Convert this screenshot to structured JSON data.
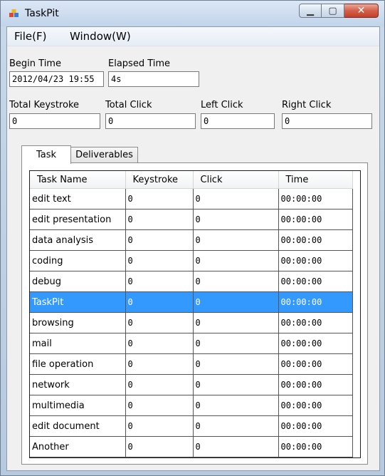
{
  "window": {
    "title": "TaskPit"
  },
  "menu": [
    "File(F)",
    "Window(W)"
  ],
  "fields": {
    "begin_time_label": "Begin Time",
    "begin_time_value": "2012/04/23 19:55",
    "elapsed_time_label": "Elapsed Time",
    "elapsed_time_value": "4s",
    "total_keystroke_label": "Total Keystroke",
    "total_keystroke_value": "0",
    "total_click_label": "Total Click",
    "total_click_value": "0",
    "left_click_label": "Left Click",
    "left_click_value": "0",
    "right_click_label": "Right Click",
    "right_click_value": "0"
  },
  "tabs": [
    "Task",
    "Deliverables"
  ],
  "table": {
    "columns": [
      "Task Name",
      "Keystroke",
      "Click",
      "Time"
    ],
    "selected_row": 5,
    "rows": [
      [
        "edit text",
        "0",
        "0",
        "00:00:00"
      ],
      [
        "edit presentation",
        "0",
        "0",
        "00:00:00"
      ],
      [
        "data analysis",
        "0",
        "0",
        "00:00:00"
      ],
      [
        "coding",
        "0",
        "0",
        "00:00:00"
      ],
      [
        "debug",
        "0",
        "0",
        "00:00:00"
      ],
      [
        "TaskPit",
        "0",
        "0",
        "00:00:00"
      ],
      [
        "browsing",
        "0",
        "0",
        "00:00:00"
      ],
      [
        "mail",
        "0",
        "0",
        "00:00:00"
      ],
      [
        "file operation",
        "0",
        "0",
        "00:00:00"
      ],
      [
        "network",
        "0",
        "0",
        "00:00:00"
      ],
      [
        "multimedia",
        "0",
        "0",
        "00:00:00"
      ],
      [
        "edit document",
        "0",
        "0",
        "00:00:00"
      ],
      [
        "Another",
        "0",
        "0",
        "00:00:00"
      ]
    ]
  },
  "colors": {
    "selection": "#3399ff",
    "close_button": "#c4402a"
  }
}
